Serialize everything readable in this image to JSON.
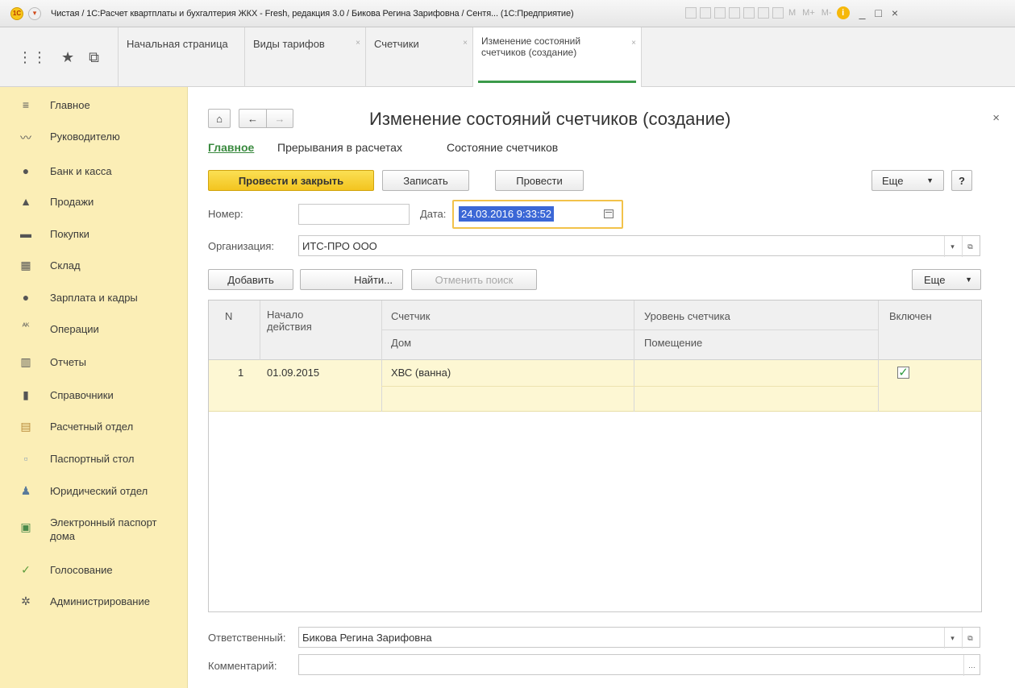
{
  "window": {
    "title": "Чистая / 1С:Расчет квартплаты и бухгалтерия ЖКХ - Fresh, редакция 3.0 / Бикова Регина Зарифовна / Сентя... (1С:Предприятие)",
    "logo": "1С",
    "toolbar_text": [
      "M",
      "M+",
      "M-"
    ],
    "controls": [
      "_",
      "□",
      "×"
    ]
  },
  "tabs": [
    {
      "label": "Начальная страница",
      "closable": false
    },
    {
      "label": "Виды тарифов",
      "closable": true
    },
    {
      "label": "Счетчики",
      "closable": true
    },
    {
      "label": "Изменение состояний счетчиков (создание)",
      "line1": "Изменение состояний",
      "line2": "счетчиков (создание)",
      "closable": true,
      "active": true
    }
  ],
  "sidebar": {
    "items": [
      {
        "label": "Главное",
        "icon": "menu-icon",
        "glyph": "≡"
      },
      {
        "label": "Руководителю",
        "icon": "trend-icon",
        "glyph": "〰"
      },
      {
        "label": "Банк и касса",
        "icon": "bank-icon",
        "glyph": "●"
      },
      {
        "label": "Продажи",
        "icon": "bag-icon",
        "glyph": "▲"
      },
      {
        "label": "Покупки",
        "icon": "cart-icon",
        "glyph": "▬"
      },
      {
        "label": "Склад",
        "icon": "warehouse-icon",
        "glyph": "▦"
      },
      {
        "label": "Зарплата и кадры",
        "icon": "person-icon",
        "glyph": "●"
      },
      {
        "label": "Операции",
        "icon": "operations-icon",
        "glyph": "ᴬᴷ"
      },
      {
        "label": "Отчеты",
        "icon": "reports-icon",
        "glyph": "▥"
      },
      {
        "label": "Справочники",
        "icon": "books-icon",
        "glyph": "▮"
      },
      {
        "label": "Расчетный отдел",
        "icon": "calc-dept-icon",
        "glyph": "▤"
      },
      {
        "label": "Паспортный стол",
        "icon": "passport-icon",
        "glyph": "▫"
      },
      {
        "label": "Юридический отдел",
        "icon": "legal-icon",
        "glyph": "♟"
      },
      {
        "label": "Электронный паспорт дома",
        "line1": "Электронный паспорт",
        "line2": "дома",
        "icon": "e-passport-icon",
        "glyph": "▣"
      },
      {
        "label": "Голосование",
        "icon": "vote-icon",
        "glyph": "✓"
      },
      {
        "label": "Администрирование",
        "icon": "gear-icon",
        "glyph": "✲"
      }
    ]
  },
  "form": {
    "title": "Изменение состояний счетчиков (создание)",
    "home_glyph": "⌂",
    "back_glyph": "←",
    "forward_glyph": "→",
    "close_glyph": "×",
    "subnav": [
      "Главное",
      "Прерывания в расчетах",
      "Состояние счетчиков"
    ],
    "buttons": {
      "post_and_close": "Провести и закрыть",
      "save": "Записать",
      "post": "Провести",
      "more": "Еще",
      "help": "?",
      "add": "Добавить",
      "find": "Найти...",
      "cancel_search": "Отменить поиск",
      "more2": "Еще"
    },
    "fields": {
      "number_label": "Номер:",
      "number_value": "",
      "date_label": "Дата:",
      "date_value": "24.03.2016  9:33:52",
      "org_label": "Организация:",
      "org_value": "ИТС-ПРО ООО",
      "responsible_label": "Ответственный:",
      "responsible_value": "Бикова Регина Зарифовна",
      "comment_label": "Комментарий:",
      "comment_value": ""
    },
    "table": {
      "headers": {
        "n": "N",
        "start_line1": "Начало",
        "start_line2": "действия",
        "meter": "Счетчик",
        "house": "Дом",
        "level": "Уровень счетчика",
        "room": "Помещение",
        "enabled": "Включен"
      },
      "rows": [
        {
          "n": "1",
          "start": "01.09.2015",
          "meter": "ХВС (ванна)",
          "house": "",
          "level": "",
          "room": "",
          "enabled": true,
          "check_glyph": "✓"
        }
      ]
    }
  },
  "colors": {
    "sidebar_bg": "#fbeeb6",
    "primary_button": "#f3c41f",
    "active_tab_underline": "#3c9a4a",
    "selected_row": "#fdf7d3",
    "date_selection": "#3b67d6"
  }
}
